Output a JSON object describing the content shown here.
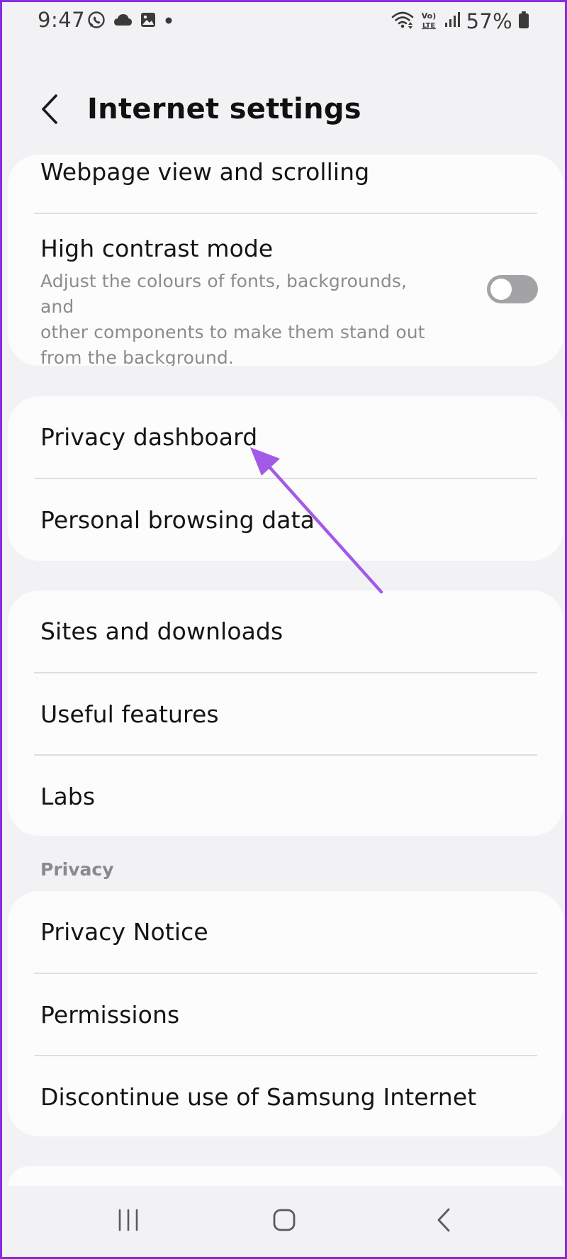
{
  "status_bar": {
    "time": "9:47",
    "battery": "57%",
    "icons": [
      "whatsapp-icon",
      "cloud-icon",
      "gallery-icon",
      "dot-icon",
      "wifi-icon",
      "volte-icon",
      "signal-icon",
      "battery-icon"
    ]
  },
  "header": {
    "title": "Internet settings",
    "back_icon": "chevron-left-icon"
  },
  "groups": [
    {
      "items": [
        {
          "label": "Webpage view and scrolling"
        },
        {
          "label": "High contrast mode",
          "description_lines": [
            "Adjust the colours of fonts, backgrounds, and",
            "other components to make them stand out",
            "from the background."
          ],
          "toggle_on": false
        }
      ]
    },
    {
      "items": [
        {
          "label": "Privacy dashboard"
        },
        {
          "label": "Personal browsing data"
        }
      ]
    },
    {
      "items": [
        {
          "label": "Sites and downloads"
        },
        {
          "label": "Useful features"
        },
        {
          "label": "Labs"
        }
      ]
    },
    {
      "section_title": "Privacy",
      "items": [
        {
          "label": "Privacy Notice"
        },
        {
          "label": "Permissions"
        },
        {
          "label": "Discontinue use of Samsung Internet"
        }
      ]
    }
  ],
  "annotation": {
    "arrow_color": "#a35ae6",
    "points_to": "Privacy dashboard"
  },
  "nav_bar": {
    "icons": [
      "recent-apps-icon",
      "home-icon",
      "back-icon"
    ]
  },
  "colors": {
    "frame_border": "#8a2be2",
    "background": "#f2f2f4",
    "card": "#fcfcfd"
  }
}
